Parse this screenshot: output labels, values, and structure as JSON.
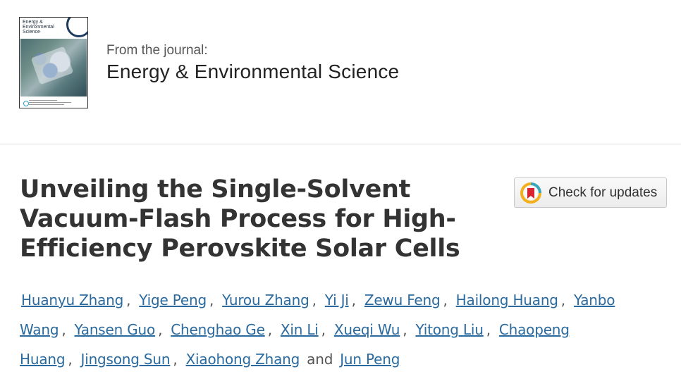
{
  "journal": {
    "cover_title": "Energy & Environmental Science",
    "from_label": "From the journal:",
    "name": "Energy & Environmental Science"
  },
  "article": {
    "title": "Unveiling the Single-Solvent Vacuum-Flash Process for High-Efficiency Perovskite Solar Cells"
  },
  "check_updates": {
    "label": "Check for updates"
  },
  "authors": [
    "Huanyu Zhang",
    "Yige Peng",
    "Yurou Zhang",
    "Yi Ji",
    "Zewu Feng",
    "Hailong Huang",
    "Yanbo Wang",
    "Yansen Guo",
    "Chenghao Ge",
    "Xin Li",
    "Xueqi Wu",
    "Yitong Liu",
    "Chaopeng Huang",
    "Jingsong Sun",
    "Xiaohong Zhang",
    "Jun Peng"
  ],
  "author_separator": ",",
  "author_conjunction": "and",
  "colors": {
    "author_link": "#2a6a9e",
    "title_text": "#333333",
    "crossmark_red": "#d9232e",
    "crossmark_yellow": "#f2b01e",
    "crossmark_teal": "#3aa6b9"
  },
  "icons": {
    "check_updates": "crossmark-icon"
  }
}
